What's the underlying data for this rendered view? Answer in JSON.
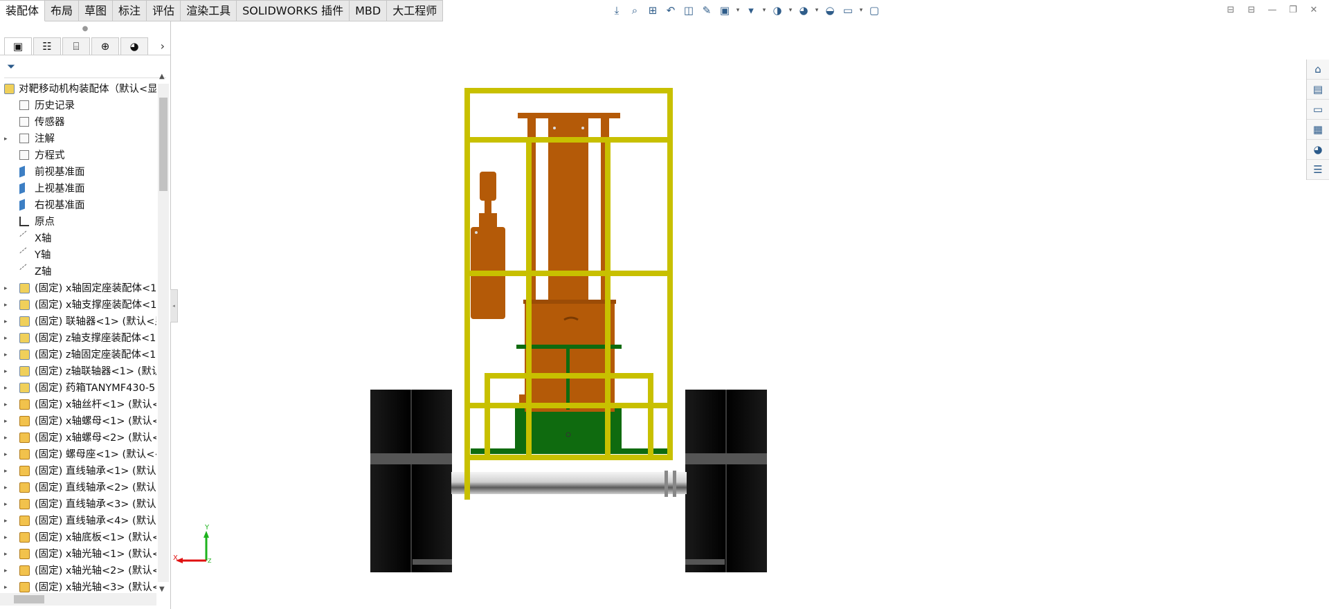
{
  "command_tabs": [
    "装配体",
    "布局",
    "草图",
    "标注",
    "评估",
    "渲染工具",
    "SOLIDWORKS 插件",
    "MBD",
    "大工程师"
  ],
  "hud_icons": [
    "view-orientation-icon",
    "zoom-to-fit-icon",
    "zoom-area-icon",
    "previous-view-icon",
    "section-view-icon",
    "dynamic-annotation-icon",
    "view-orientation-box-icon",
    "display-style-icon",
    "hide-show-icon",
    "edit-appearance-icon",
    "apply-scene-icon",
    "view-settings-icon",
    "3d-view-icon"
  ],
  "tree": {
    "root": "对靶移动机构装配体（默认<显",
    "items": [
      {
        "label": "历史记录",
        "icon": "history-icon",
        "expand": false
      },
      {
        "label": "传感器",
        "icon": "sensor-icon",
        "expand": false
      },
      {
        "label": "注解",
        "icon": "annotation-icon",
        "expand": true
      },
      {
        "label": "方程式",
        "icon": "equation-icon",
        "expand": false
      },
      {
        "label": "前视基准面",
        "icon": "plane-icon",
        "expand": false
      },
      {
        "label": "上视基准面",
        "icon": "plane-icon",
        "expand": false
      },
      {
        "label": "右视基准面",
        "icon": "plane-icon",
        "expand": false
      },
      {
        "label": "原点",
        "icon": "origin-icon",
        "expand": false
      },
      {
        "label": "X轴",
        "icon": "axis-icon",
        "expand": false
      },
      {
        "label": "Y轴",
        "icon": "axis-icon",
        "expand": false
      },
      {
        "label": "Z轴",
        "icon": "axis-icon",
        "expand": false
      },
      {
        "label": "(固定) x轴固定座装配体<1",
        "icon": "assembly-icon",
        "expand": true
      },
      {
        "label": "(固定) x轴支撑座装配体<1",
        "icon": "assembly-icon",
        "expand": true
      },
      {
        "label": "(固定) 联轴器<1> (默认<显",
        "icon": "assembly-icon",
        "expand": true
      },
      {
        "label": "(固定) z轴支撑座装配体<1",
        "icon": "assembly-icon",
        "expand": true
      },
      {
        "label": "(固定) z轴固定座装配体<1",
        "icon": "assembly-icon",
        "expand": true
      },
      {
        "label": "(固定) z轴联轴器<1> (默认",
        "icon": "assembly-icon",
        "expand": true
      },
      {
        "label": "(固定) 药箱TANYMF430-5",
        "icon": "assembly-icon",
        "expand": true
      },
      {
        "label": "(固定) x轴丝杆<1> (默认<",
        "icon": "part-icon",
        "expand": true
      },
      {
        "label": "(固定) x轴螺母<1> (默认<",
        "icon": "part-icon",
        "expand": true
      },
      {
        "label": "(固定) x轴螺母<2> (默认<",
        "icon": "part-icon",
        "expand": true
      },
      {
        "label": "(固定) 螺母座<1> (默认<<",
        "icon": "part-icon",
        "expand": true
      },
      {
        "label": "(固定) 直线轴承<1> (默认",
        "icon": "part-icon",
        "expand": true
      },
      {
        "label": "(固定) 直线轴承<2> (默认",
        "icon": "part-icon",
        "expand": true
      },
      {
        "label": "(固定) 直线轴承<3> (默认",
        "icon": "part-icon",
        "expand": true
      },
      {
        "label": "(固定) 直线轴承<4> (默认",
        "icon": "part-icon",
        "expand": true
      },
      {
        "label": "(固定) x轴底板<1> (默认<",
        "icon": "part-icon",
        "expand": true
      },
      {
        "label": "(固定) x轴光轴<1> (默认<",
        "icon": "part-icon",
        "expand": true
      },
      {
        "label": "(固定) x轴光轴<2> (默认<",
        "icon": "part-icon",
        "expand": true
      },
      {
        "label": "(固定) x轴光轴<3> (默认<",
        "icon": "part-icon",
        "expand": true
      }
    ]
  },
  "triad": {
    "x": "X",
    "y": "Y",
    "z": "Z"
  },
  "colors": {
    "frame": "#c8c000",
    "orange": "#b45a08",
    "green": "#0f6b0f",
    "track": "#000000",
    "shaft": "#9a9a9a"
  }
}
